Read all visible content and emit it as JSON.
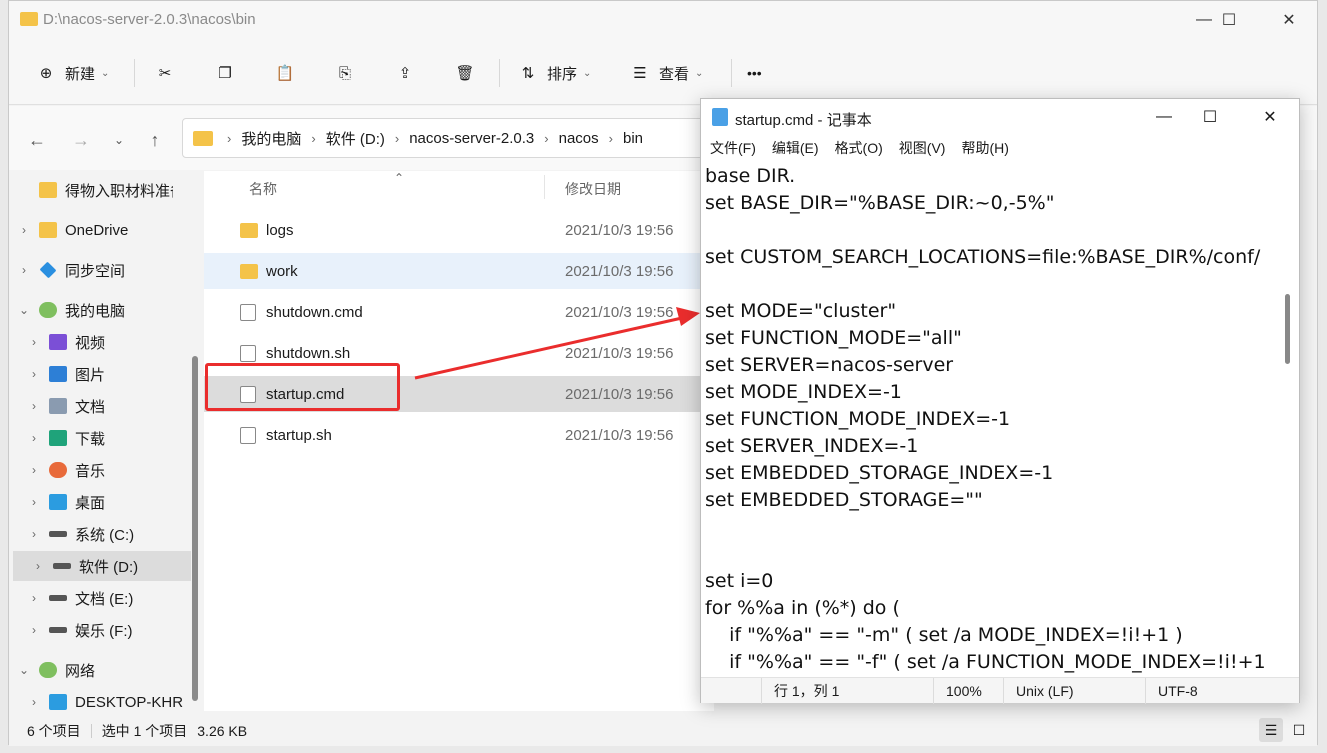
{
  "explorer": {
    "title": "D:\\nacos-server-2.0.3\\nacos\\bin",
    "toolbar": {
      "new_label": "新建",
      "sort_label": "排序",
      "view_label": "查看",
      "more_label": "•••"
    },
    "breadcrumb": [
      "我的电脑",
      "软件 (D:)",
      "nacos-server-2.0.3",
      "nacos",
      "bin"
    ],
    "sidebar": {
      "items": [
        {
          "label": "得物入职材料准备",
          "icon": "folder-icon",
          "color": "#f4c349"
        },
        {
          "label": "OneDrive",
          "icon": "folder-icon",
          "color": "#f4c349"
        },
        {
          "label": "同步空间",
          "icon": "sync-icon",
          "color": "#2a8fe0"
        },
        {
          "label": "我的电脑",
          "icon": "computer-icon",
          "color": "#7fbf5f"
        },
        {
          "label": "视频",
          "icon": "video-icon",
          "color": "#7b4fd6"
        },
        {
          "label": "图片",
          "icon": "image-icon",
          "color": "#2d7fd6"
        },
        {
          "label": "文档",
          "icon": "document-icon",
          "color": "#8a9bb0"
        },
        {
          "label": "下载",
          "icon": "download-icon",
          "color": "#1fa37a"
        },
        {
          "label": "音乐",
          "icon": "music-icon",
          "color": "#e86a3a"
        },
        {
          "label": "桌面",
          "icon": "desktop-icon",
          "color": "#2b9ce0"
        },
        {
          "label": "系统 (C:)",
          "icon": "drive-icon",
          "color": "#555555"
        },
        {
          "label": "软件 (D:)",
          "icon": "drive-icon",
          "color": "#555555"
        },
        {
          "label": "文档 (E:)",
          "icon": "drive-icon",
          "color": "#555555"
        },
        {
          "label": "娱乐 (F:)",
          "icon": "drive-icon",
          "color": "#555555"
        },
        {
          "label": "网络",
          "icon": "network-icon",
          "color": "#7fbf5f"
        },
        {
          "label": "DESKTOP-KHR",
          "icon": "monitor-icon",
          "color": "#2b9ce0"
        }
      ]
    },
    "columns": {
      "name": "名称",
      "modified": "修改日期"
    },
    "files": [
      {
        "name": "logs",
        "date": "2021/10/3 19:56",
        "type": "folder"
      },
      {
        "name": "work",
        "date": "2021/10/3 19:56",
        "type": "folder"
      },
      {
        "name": "shutdown.cmd",
        "date": "2021/10/3 19:56",
        "type": "script"
      },
      {
        "name": "shutdown.sh",
        "date": "2021/10/3 19:56",
        "type": "script"
      },
      {
        "name": "startup.cmd",
        "date": "2021/10/3 19:56",
        "type": "script"
      },
      {
        "name": "startup.sh",
        "date": "2021/10/3 19:56",
        "type": "script"
      }
    ],
    "status": {
      "count": "6 个项目",
      "selected": "选中 1 个项目",
      "size": "3.26 KB"
    }
  },
  "notepad": {
    "title": "startup.cmd - 记事本",
    "menu": [
      "文件(F)",
      "编辑(E)",
      "格式(O)",
      "视图(V)",
      "帮助(H)"
    ],
    "content": "base DIR.\nset BASE_DIR=\"%BASE_DIR:~0,-5%\"\n\nset CUSTOM_SEARCH_LOCATIONS=file:%BASE_DIR%/conf/\n\nset MODE=\"cluster\"\nset FUNCTION_MODE=\"all\"\nset SERVER=nacos-server\nset MODE_INDEX=-1\nset FUNCTION_MODE_INDEX=-1\nset SERVER_INDEX=-1\nset EMBEDDED_STORAGE_INDEX=-1\nset EMBEDDED_STORAGE=\"\"\n\n\nset i=0\nfor %%a in (%*) do (\n    if \"%%a\" == \"-m\" ( set /a MODE_INDEX=!i!+1 )\n    if \"%%a\" == \"-f\" ( set /a FUNCTION_MODE_INDEX=!i!+1",
    "status": {
      "position": "行 1，列 1",
      "zoom": "100%",
      "eol": "Unix (LF)",
      "encoding": "UTF-8"
    }
  },
  "colors": {
    "highlight": "#ea2d2d",
    "selected_row": "#dcdcdc",
    "hover_row": "#e8f1fb"
  }
}
